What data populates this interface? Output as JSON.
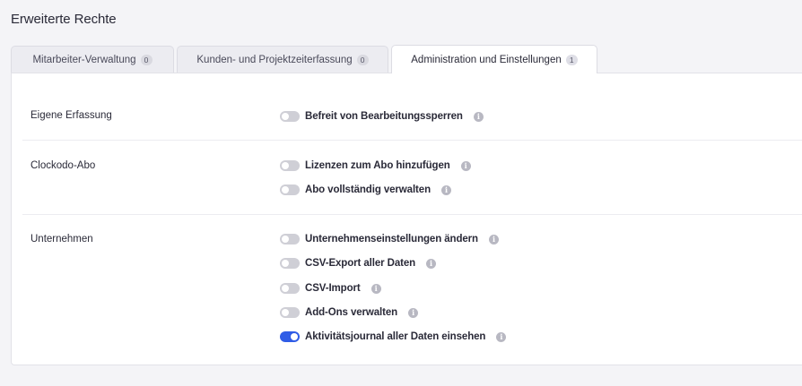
{
  "page": {
    "title": "Erweiterte Rechte"
  },
  "tabs": [
    {
      "label": "Mitarbeiter-Verwaltung",
      "count": "0",
      "active": false
    },
    {
      "label": "Kunden- und Projektzeiterfassung",
      "count": "0",
      "active": false
    },
    {
      "label": "Administration und Einstellungen",
      "count": "1",
      "active": true
    }
  ],
  "sections": [
    {
      "label": "Eigene Erfassung",
      "permissions": [
        {
          "label": "Befreit von Bearbeitungssperren",
          "enabled": false
        }
      ]
    },
    {
      "label": "Clockodo-Abo",
      "permissions": [
        {
          "label": "Lizenzen zum Abo hinzufügen",
          "enabled": false
        },
        {
          "label": "Abo vollständig verwalten",
          "enabled": false
        }
      ]
    },
    {
      "label": "Unternehmen",
      "permissions": [
        {
          "label": "Unternehmenseinstellungen ändern",
          "enabled": false
        },
        {
          "label": "CSV-Export aller Daten",
          "enabled": false
        },
        {
          "label": "CSV-Import",
          "enabled": false
        },
        {
          "label": "Add-Ons verwalten",
          "enabled": false
        },
        {
          "label": "Aktivitätsjournal aller Daten einsehen",
          "enabled": true
        }
      ]
    }
  ],
  "colors": {
    "toggle_on": "#2f5ce6",
    "toggle_off": "#cfcfd6",
    "info_icon": "#b8b8c2"
  },
  "icons": {
    "info": "info-icon"
  }
}
